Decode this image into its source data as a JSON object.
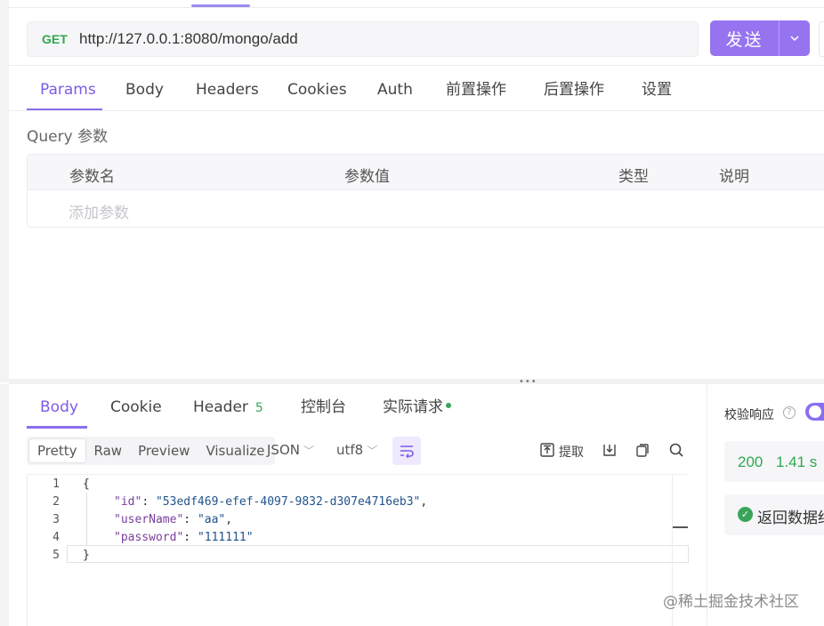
{
  "request": {
    "method": "GET",
    "url": "http://127.0.0.1:8080/mongo/add",
    "send_label": "发送"
  },
  "request_tabs": [
    "Params",
    "Body",
    "Headers",
    "Cookies",
    "Auth",
    "前置操作",
    "后置操作",
    "设置"
  ],
  "query": {
    "title": "Query 参数",
    "columns": [
      "参数名",
      "参数值",
      "类型",
      "说明"
    ],
    "add_placeholder": "添加参数"
  },
  "response_tabs": {
    "body": "Body",
    "cookie": "Cookie",
    "header": "Header",
    "header_count": "5",
    "console": "控制台",
    "actual_request": "实际请求"
  },
  "response_toolbar": {
    "views": [
      "Pretty",
      "Raw",
      "Preview",
      "Visualize"
    ],
    "format": "JSON",
    "encoding": "utf8",
    "extract_label": "提取"
  },
  "response_body": {
    "line_numbers": [
      "1",
      "2",
      "3",
      "4",
      "5"
    ],
    "open_brace": "{",
    "close_brace": "}",
    "fields": [
      {
        "key": "\"id\"",
        "value": "\"53edf469-efef-4097-9832-d307e4716eb3\"",
        "suffix": ","
      },
      {
        "key": "\"userName\"",
        "value": "\"aa\"",
        "suffix": ","
      },
      {
        "key": "\"password\"",
        "value": "\"111111\"",
        "suffix": ""
      }
    ]
  },
  "validation": {
    "label": "校验响应",
    "help": "?",
    "status_code": "200",
    "time": "1.41 s",
    "assert_text": "返回数据结"
  },
  "watermark": "@稀土掘金技术社区",
  "colors": {
    "accent": "#8a6ef0",
    "success": "#2fa84f"
  }
}
